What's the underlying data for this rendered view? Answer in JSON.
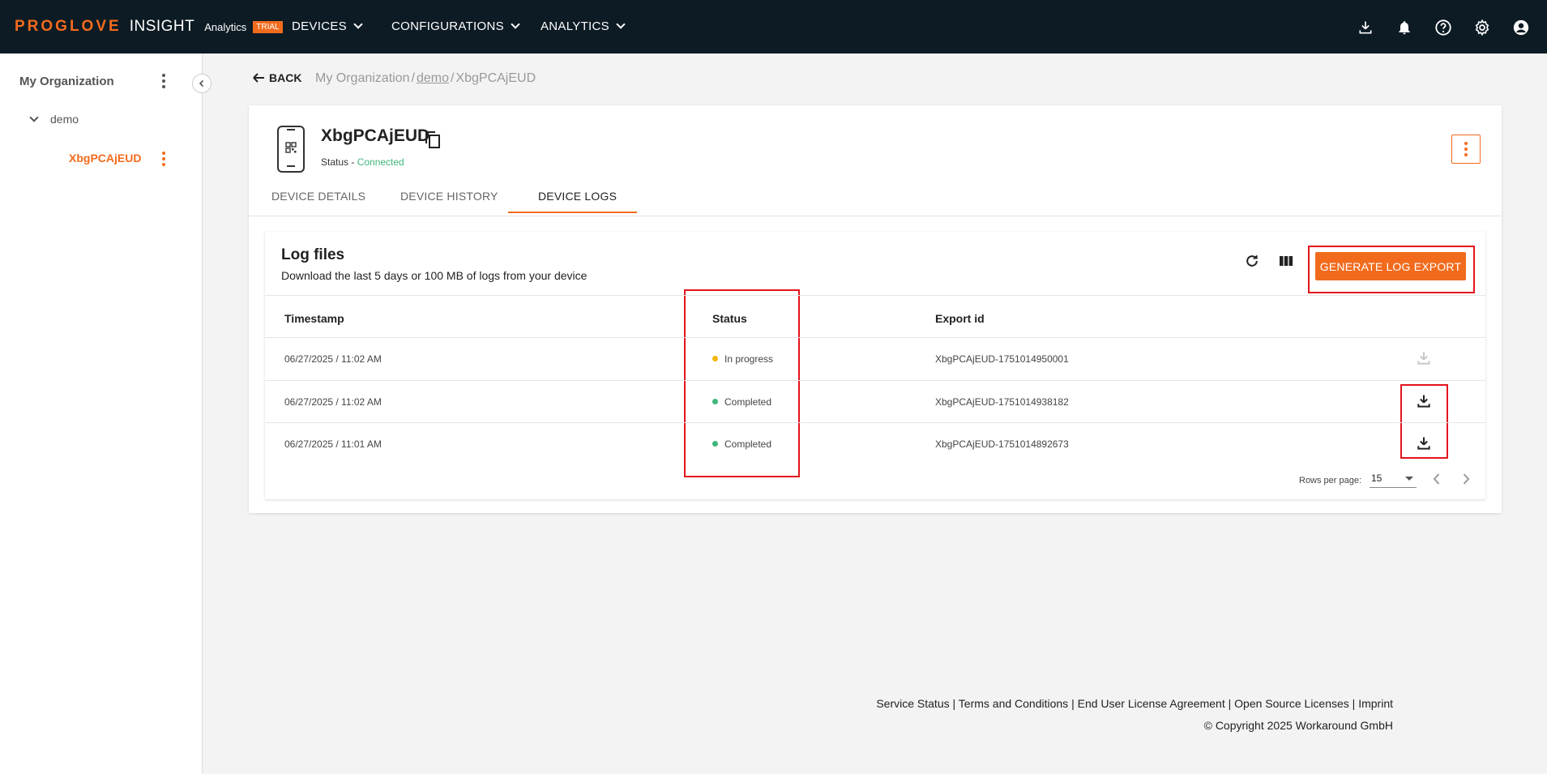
{
  "header": {
    "brand": "PROGLOVE",
    "product": "INSIGHT",
    "analytics": "Analytics",
    "trial_badge": "TRIAL",
    "nav": [
      "DEVICES",
      "CONFIGURATIONS",
      "ANALYTICS"
    ],
    "icons": [
      "download-icon",
      "bell-icon",
      "help-icon",
      "gear-icon",
      "account-icon"
    ]
  },
  "sidebar": {
    "root": "My Organization",
    "group": "demo",
    "device": "XbgPCAjEUD"
  },
  "breadcrumb": {
    "back": "BACK",
    "org": "My Organization",
    "sep1": "/",
    "group": "demo",
    "sep2": "/",
    "device": "XbgPCAjEUD"
  },
  "device": {
    "name": "XbgPCAjEUD",
    "status_label": "Status - ",
    "status_value": "Connected"
  },
  "tabs": [
    "DEVICE DETAILS",
    "DEVICE HISTORY",
    "DEVICE LOGS"
  ],
  "active_tab": "DEVICE LOGS",
  "logs": {
    "title": "Log files",
    "subtitle": "Download the last 5 days or 100 MB of logs from your device",
    "generate_button": "GENERATE LOG EXPORT",
    "columns": [
      "Timestamp",
      "Status",
      "Export id"
    ],
    "rows": [
      {
        "timestamp": "06/27/2025 / 11:02 AM",
        "status": "In progress",
        "status_color": "#f2b807",
        "export_id": "XbgPCAjEUD-1751014950001",
        "download_enabled": false
      },
      {
        "timestamp": "06/27/2025 / 11:02 AM",
        "status": "Completed",
        "status_color": "#3fb67a",
        "export_id": "XbgPCAjEUD-1751014938182",
        "download_enabled": true
      },
      {
        "timestamp": "06/27/2025 / 11:01 AM",
        "status": "Completed",
        "status_color": "#3fb67a",
        "export_id": "XbgPCAjEUD-1751014892673",
        "download_enabled": true
      }
    ],
    "rows_per_page_label": "Rows per page:",
    "rows_per_page_value": "15"
  },
  "footer": {
    "links": [
      "Service Status",
      "Terms and Conditions",
      "End User License Agreement",
      "Open Source Licenses",
      "Imprint"
    ],
    "separator": " | ",
    "copyright": "© Copyright 2025 Workaround GmbH"
  },
  "colors": {
    "accent": "#f26b1d",
    "topbar": "#0d1b24",
    "highlight": "#e3141c",
    "connected": "#3fb67a"
  }
}
